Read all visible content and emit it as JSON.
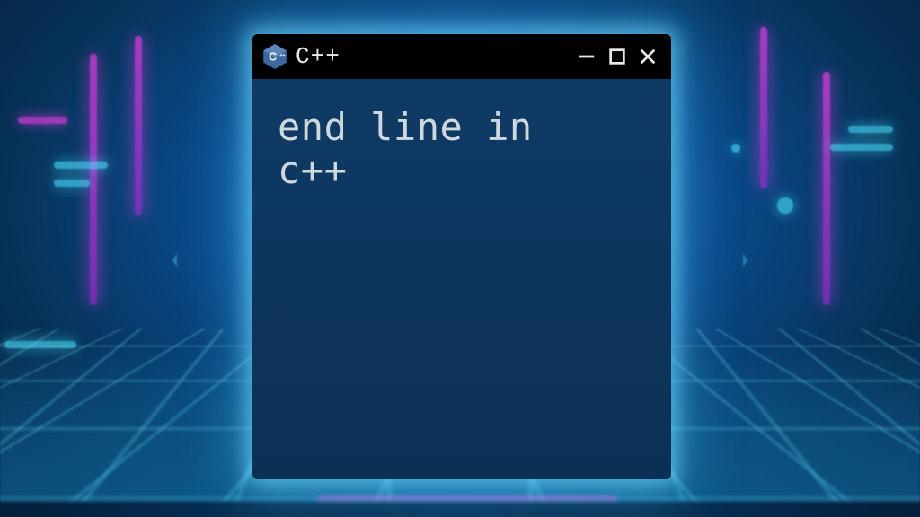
{
  "window": {
    "title": "C++",
    "icon_name": "cpp-icon",
    "content_text": "end line in\nc++"
  },
  "controls": {
    "minimize": "minimize",
    "maximize": "maximize",
    "close": "close"
  },
  "colors": {
    "neon_cyan": "#4be3ff",
    "neon_magenta": "#ff3df2",
    "terminal_bg": "#0d365e",
    "titlebar_bg": "#000000",
    "text": "#cfd8dc"
  }
}
